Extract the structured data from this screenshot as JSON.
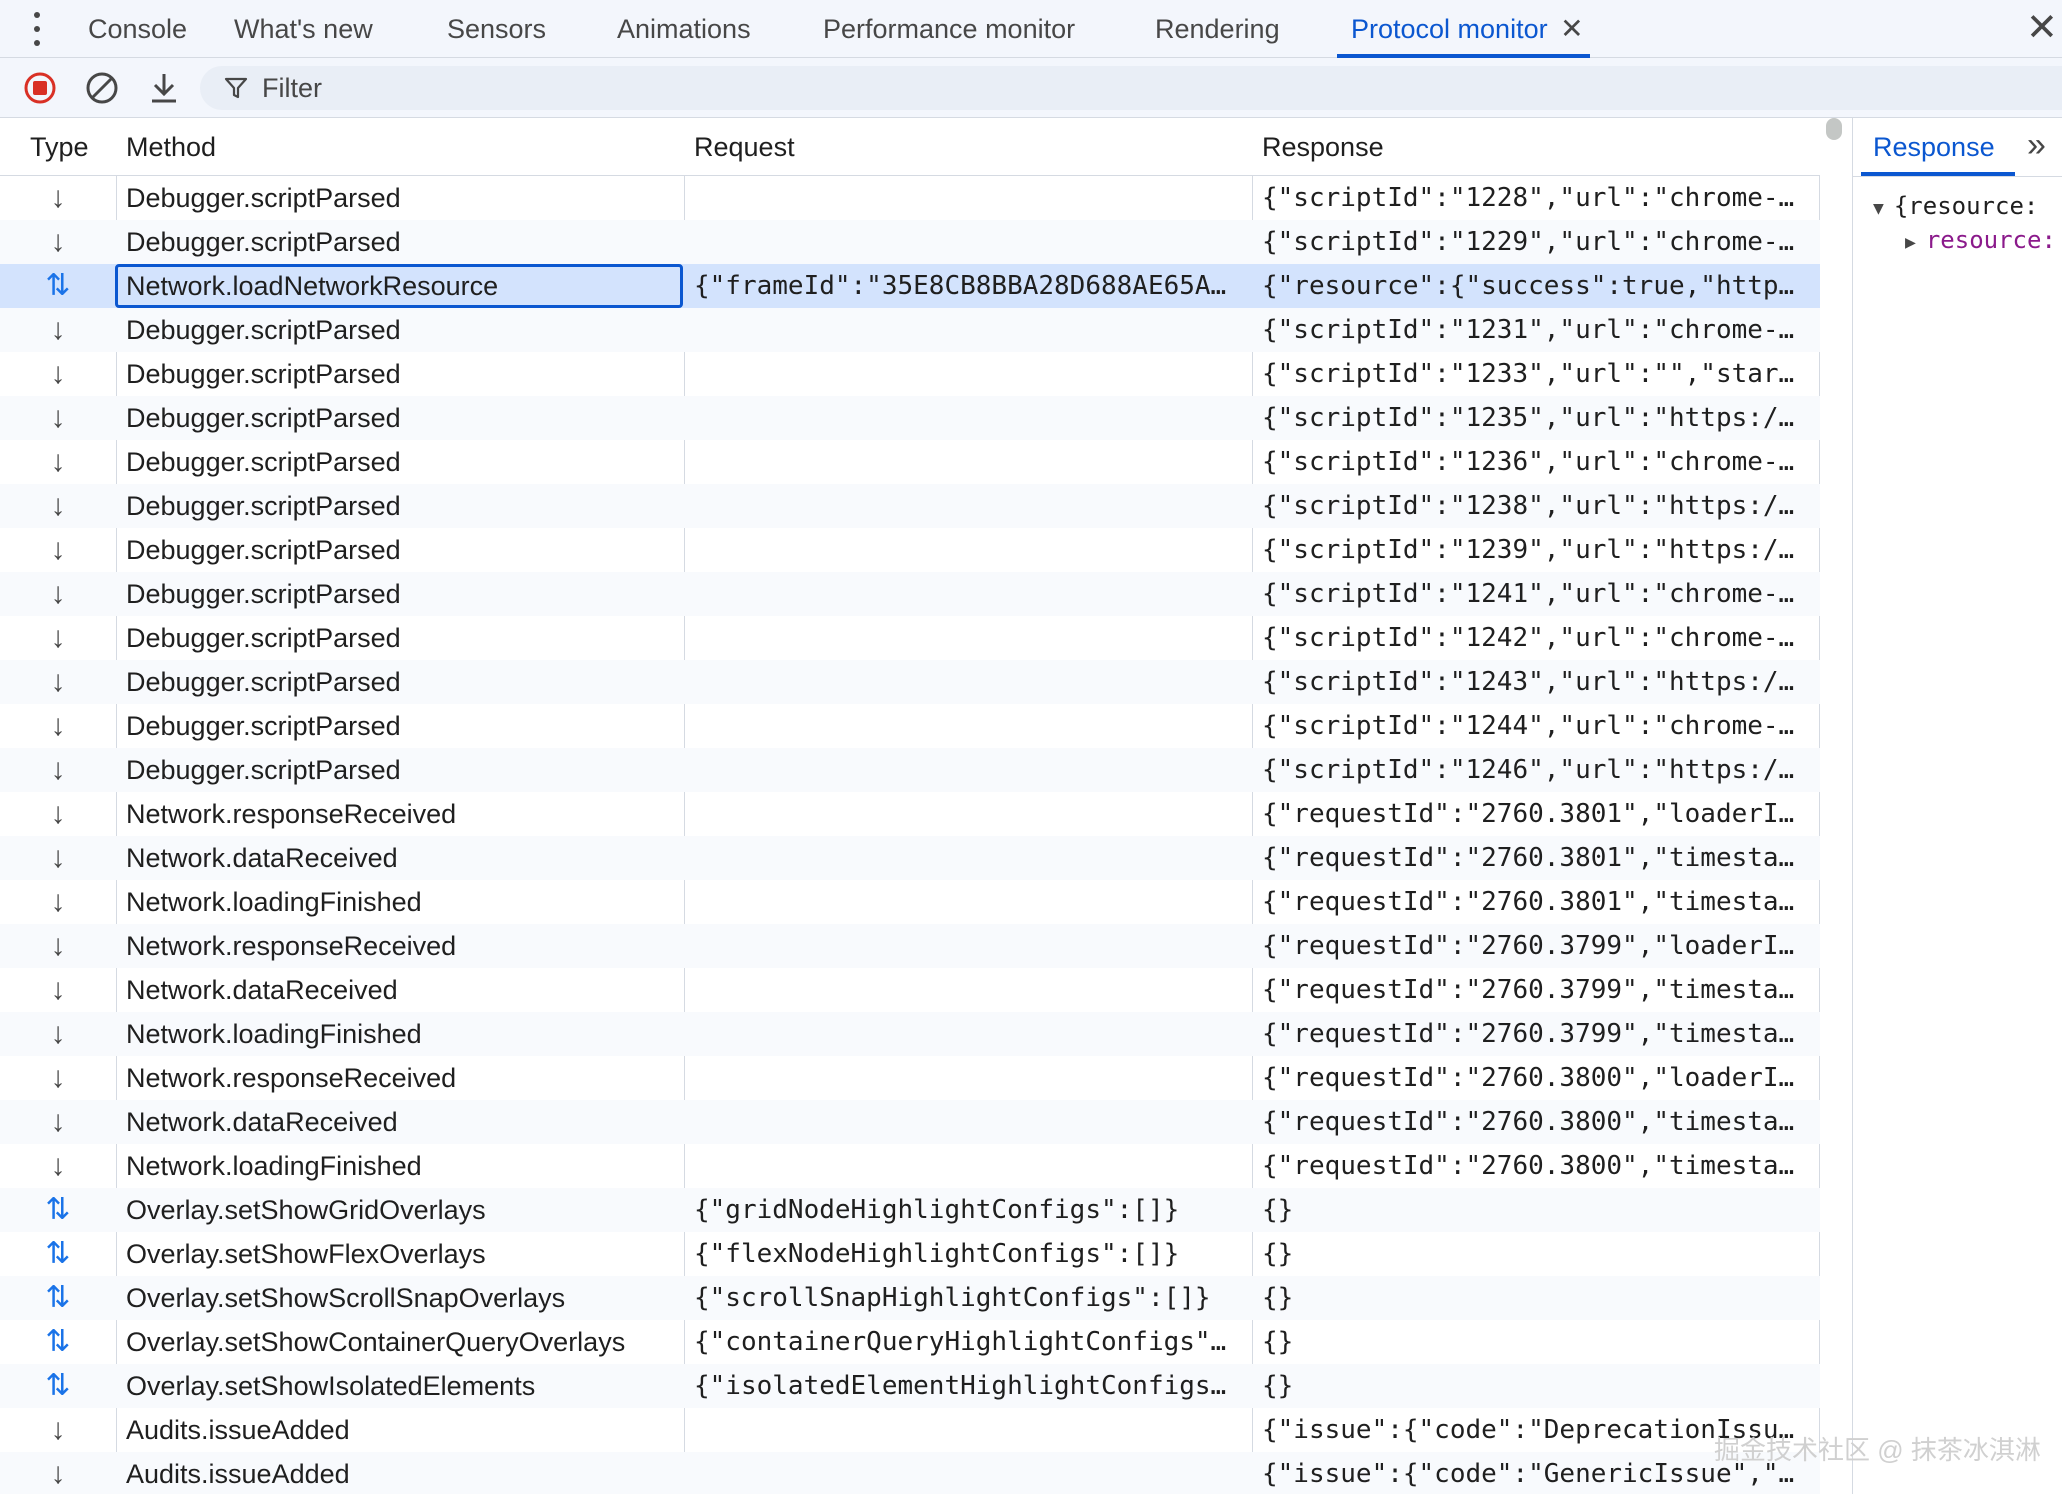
{
  "tabs": [
    "Console",
    "What's new",
    "Sensors",
    "Animations",
    "Performance monitor",
    "Rendering",
    "Protocol monitor"
  ],
  "active_tab": "Protocol monitor",
  "tab_close": "✕",
  "panel_close": "✕",
  "toolbar": {
    "record_icon": "record-stop-icon",
    "clear_icon": "clear-icon",
    "download_icon": "download-icon",
    "filter_placeholder": "Filter"
  },
  "table": {
    "headers": {
      "type": "Type",
      "method": "Method",
      "request": "Request",
      "response": "Response"
    },
    "rows": [
      {
        "type": "↓",
        "dir": "recv",
        "method": "Debugger.scriptParsed",
        "request": "",
        "response": "{\"scriptId\":\"1228\",\"url\":\"chrome-…"
      },
      {
        "type": "↓",
        "dir": "recv",
        "method": "Debugger.scriptParsed",
        "request": "",
        "response": "{\"scriptId\":\"1229\",\"url\":\"chrome-…"
      },
      {
        "type": "⇅",
        "dir": "both",
        "method": "Network.loadNetworkResource",
        "request": "{\"frameId\":\"35E8CB8BBA28D688AE65A…",
        "response": "{\"resource\":{\"success\":true,\"http…",
        "selected": true
      },
      {
        "type": "↓",
        "dir": "recv",
        "method": "Debugger.scriptParsed",
        "request": "",
        "response": "{\"scriptId\":\"1231\",\"url\":\"chrome-…"
      },
      {
        "type": "↓",
        "dir": "recv",
        "method": "Debugger.scriptParsed",
        "request": "",
        "response": "{\"scriptId\":\"1233\",\"url\":\"\",\"star…"
      },
      {
        "type": "↓",
        "dir": "recv",
        "method": "Debugger.scriptParsed",
        "request": "",
        "response": "{\"scriptId\":\"1235\",\"url\":\"https:/…"
      },
      {
        "type": "↓",
        "dir": "recv",
        "method": "Debugger.scriptParsed",
        "request": "",
        "response": "{\"scriptId\":\"1236\",\"url\":\"chrome-…"
      },
      {
        "type": "↓",
        "dir": "recv",
        "method": "Debugger.scriptParsed",
        "request": "",
        "response": "{\"scriptId\":\"1238\",\"url\":\"https:/…"
      },
      {
        "type": "↓",
        "dir": "recv",
        "method": "Debugger.scriptParsed",
        "request": "",
        "response": "{\"scriptId\":\"1239\",\"url\":\"https:/…"
      },
      {
        "type": "↓",
        "dir": "recv",
        "method": "Debugger.scriptParsed",
        "request": "",
        "response": "{\"scriptId\":\"1241\",\"url\":\"chrome-…"
      },
      {
        "type": "↓",
        "dir": "recv",
        "method": "Debugger.scriptParsed",
        "request": "",
        "response": "{\"scriptId\":\"1242\",\"url\":\"chrome-…"
      },
      {
        "type": "↓",
        "dir": "recv",
        "method": "Debugger.scriptParsed",
        "request": "",
        "response": "{\"scriptId\":\"1243\",\"url\":\"https:/…"
      },
      {
        "type": "↓",
        "dir": "recv",
        "method": "Debugger.scriptParsed",
        "request": "",
        "response": "{\"scriptId\":\"1244\",\"url\":\"chrome-…"
      },
      {
        "type": "↓",
        "dir": "recv",
        "method": "Debugger.scriptParsed",
        "request": "",
        "response": "{\"scriptId\":\"1246\",\"url\":\"https:/…"
      },
      {
        "type": "↓",
        "dir": "recv",
        "method": "Network.responseReceived",
        "request": "",
        "response": "{\"requestId\":\"2760.3801\",\"loaderI…"
      },
      {
        "type": "↓",
        "dir": "recv",
        "method": "Network.dataReceived",
        "request": "",
        "response": "{\"requestId\":\"2760.3801\",\"timesta…"
      },
      {
        "type": "↓",
        "dir": "recv",
        "method": "Network.loadingFinished",
        "request": "",
        "response": "{\"requestId\":\"2760.3801\",\"timesta…"
      },
      {
        "type": "↓",
        "dir": "recv",
        "method": "Network.responseReceived",
        "request": "",
        "response": "{\"requestId\":\"2760.3799\",\"loaderI…"
      },
      {
        "type": "↓",
        "dir": "recv",
        "method": "Network.dataReceived",
        "request": "",
        "response": "{\"requestId\":\"2760.3799\",\"timesta…"
      },
      {
        "type": "↓",
        "dir": "recv",
        "method": "Network.loadingFinished",
        "request": "",
        "response": "{\"requestId\":\"2760.3799\",\"timesta…"
      },
      {
        "type": "↓",
        "dir": "recv",
        "method": "Network.responseReceived",
        "request": "",
        "response": "{\"requestId\":\"2760.3800\",\"loaderI…"
      },
      {
        "type": "↓",
        "dir": "recv",
        "method": "Network.dataReceived",
        "request": "",
        "response": "{\"requestId\":\"2760.3800\",\"timesta…"
      },
      {
        "type": "↓",
        "dir": "recv",
        "method": "Network.loadingFinished",
        "request": "",
        "response": "{\"requestId\":\"2760.3800\",\"timesta…"
      },
      {
        "type": "⇅",
        "dir": "both",
        "method": "Overlay.setShowGridOverlays",
        "request": "{\"gridNodeHighlightConfigs\":[]}",
        "response": "{}"
      },
      {
        "type": "⇅",
        "dir": "both",
        "method": "Overlay.setShowFlexOverlays",
        "request": "{\"flexNodeHighlightConfigs\":[]}",
        "response": "{}"
      },
      {
        "type": "⇅",
        "dir": "both",
        "method": "Overlay.setShowScrollSnapOverlays",
        "request": "{\"scrollSnapHighlightConfigs\":[]}",
        "response": "{}"
      },
      {
        "type": "⇅",
        "dir": "both",
        "method": "Overlay.setShowContainerQueryOverlays",
        "request": "{\"containerQueryHighlightConfigs\"…",
        "response": "{}"
      },
      {
        "type": "⇅",
        "dir": "both",
        "method": "Overlay.setShowIsolatedElements",
        "request": "{\"isolatedElementHighlightConfigs…",
        "response": "{}"
      },
      {
        "type": "↓",
        "dir": "recv",
        "method": "Audits.issueAdded",
        "request": "",
        "response": "{\"issue\":{\"code\":\"DeprecationIssu…"
      },
      {
        "type": "↓",
        "dir": "recv",
        "method": "Audits.issueAdded",
        "request": "",
        "response": "{\"issue\":{\"code\":\"GenericIssue\",\"…"
      }
    ]
  },
  "side_panel": {
    "tab_label": "Response",
    "more_icon": "»",
    "tree": [
      {
        "toggle": "▼",
        "text": "{resource: "
      },
      {
        "toggle": "▶",
        "text": "resource:"
      }
    ]
  },
  "watermark": "掘金技术社区 @ 抹茶冰淇淋"
}
